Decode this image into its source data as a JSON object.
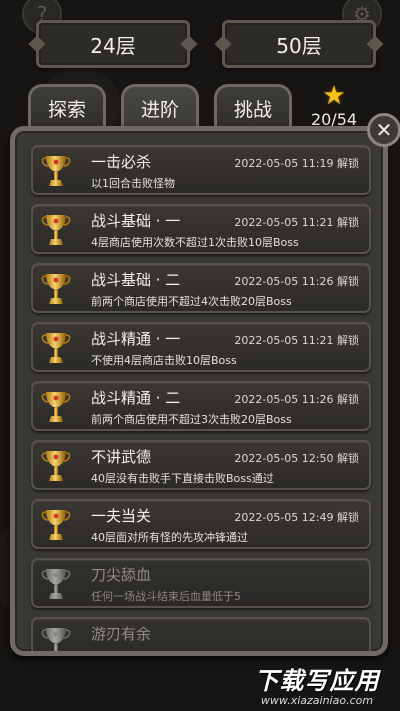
{
  "header": {
    "left_floor": "24层",
    "right_floor": "50层"
  },
  "tabs": [
    {
      "label": "探索"
    },
    {
      "label": "进阶"
    },
    {
      "label": "挑战"
    }
  ],
  "stars": {
    "icon": "star-icon",
    "count": "20/54",
    "color": "#f4c21a"
  },
  "close_icon": "✕",
  "achievements": [
    {
      "title": "一击必杀",
      "date": "2022-05-05 11:19 解锁",
      "desc": "以1回合击败怪物",
      "unlocked": true
    },
    {
      "title": "战斗基础 · 一",
      "date": "2022-05-05 11:21 解锁",
      "desc": "4层商店使用次数不超过1次击败10层Boss",
      "unlocked": true
    },
    {
      "title": "战斗基础 · 二",
      "date": "2022-05-05 11:26 解锁",
      "desc": "前两个商店使用不超过4次击败20层Boss",
      "unlocked": true
    },
    {
      "title": "战斗精通 · 一",
      "date": "2022-05-05 11:21 解锁",
      "desc": "不使用4层商店击败10层Boss",
      "unlocked": true
    },
    {
      "title": "战斗精通 · 二",
      "date": "2022-05-05 11:26 解锁",
      "desc": "前两个商店使用不超过3次击败20层Boss",
      "unlocked": true
    },
    {
      "title": "不讲武德",
      "date": "2022-05-05 12:50 解锁",
      "desc": "40层没有击败手下直接击败Boss通过",
      "unlocked": true
    },
    {
      "title": "一夫当关",
      "date": "2022-05-05 12:49 解锁",
      "desc": "40层面对所有怪的先攻冲锋通过",
      "unlocked": true
    },
    {
      "title": "刀尖舔血",
      "date": "",
      "desc": "任何一场战斗结束后血量低于5",
      "unlocked": false
    },
    {
      "title": "游刃有余",
      "date": "",
      "desc": "",
      "unlocked": false
    }
  ],
  "watermark": {
    "main": "下载写应用",
    "sub": "www.xiazainiao.com"
  }
}
